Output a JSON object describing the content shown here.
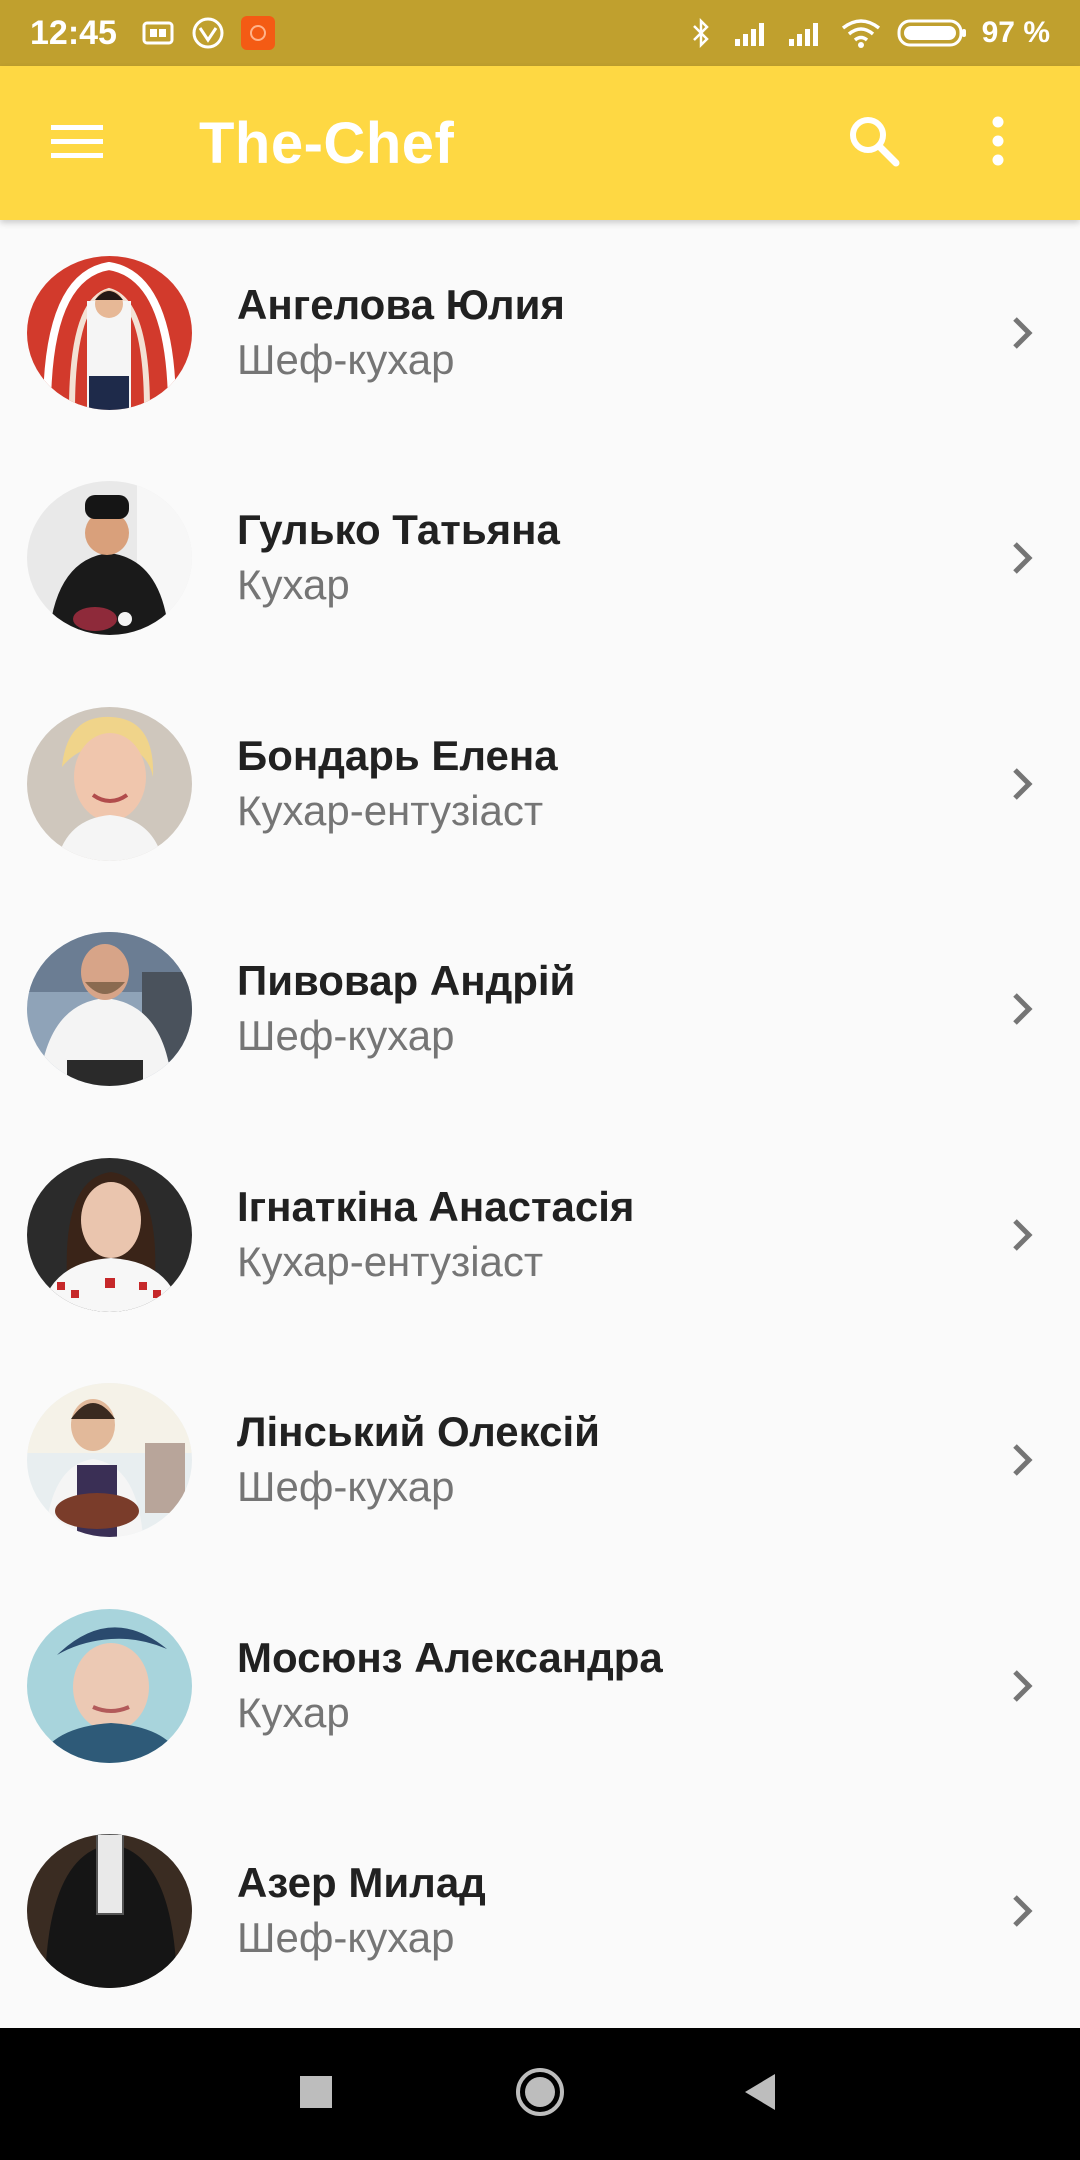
{
  "status_bar": {
    "time": "12:45",
    "battery": "97 %",
    "icons": [
      "sim-card-icon",
      "vpn-icon",
      "app-notification-icon",
      "bluetooth-icon",
      "signal-icon",
      "signal-icon",
      "wifi-icon",
      "battery-icon"
    ]
  },
  "app_bar": {
    "title": "The-Chef",
    "menu_icon": "hamburger-menu-icon",
    "search_icon": "search-icon",
    "overflow_icon": "more-vert-icon"
  },
  "chefs": [
    {
      "name": "Ангелова Юлия",
      "role": "Шеф-кухар"
    },
    {
      "name": "Гулько Татьяна",
      "role": "Кухар"
    },
    {
      "name": "Бондарь Елена",
      "role": "Кухар-ентузіаст"
    },
    {
      "name": "Пивовар Андрій",
      "role": "Шеф-кухар"
    },
    {
      "name": "Ігнаткіна Анастасія",
      "role": "Кухар-ентузіаст"
    },
    {
      "name": "Лінський Олексій",
      "role": "Шеф-кухар"
    },
    {
      "name": "Мосюнз Александра",
      "role": "Кухар"
    },
    {
      "name": "Азер Милад",
      "role": "Шеф-кухар"
    }
  ],
  "nav_bar": {
    "recents_icon": "square-recents-icon",
    "home_icon": "circle-home-icon",
    "back_icon": "triangle-back-icon"
  },
  "colors": {
    "status_bar": "#c0a02e",
    "app_bar": "#fed843",
    "background": "#fafafa",
    "name_text": "#212121",
    "role_text": "#757575"
  }
}
